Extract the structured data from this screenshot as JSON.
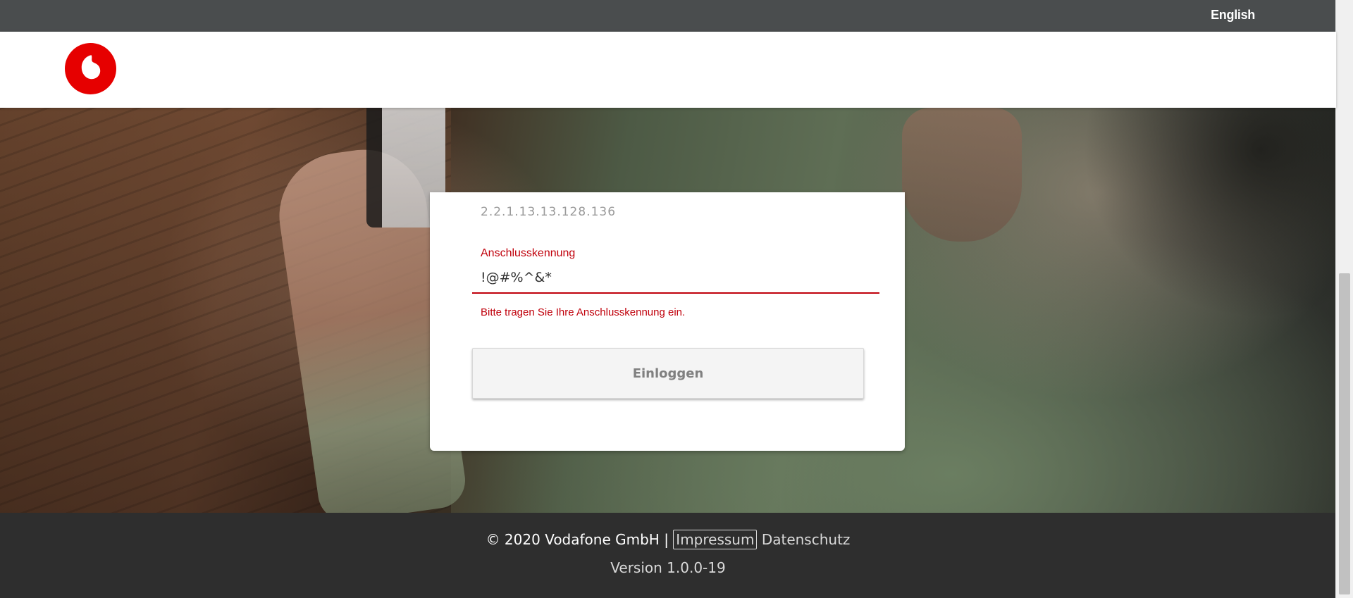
{
  "topbar": {
    "language_link": "English"
  },
  "header": {
    "logo_icon": "vodafone-logo-icon",
    "brand_color": "#e60000"
  },
  "login_form": {
    "previous_field_value": "2.2.1.13.13.128.136",
    "field_label": "Anschlusskennung",
    "field_value": "!@#%^&*",
    "field_error": "Bitte tragen Sie Ihre Anschlusskennung ein.",
    "submit_label": "Einloggen",
    "error_color": "#c0000b"
  },
  "footer": {
    "copyright": "© 2020 Vodafone GmbH |",
    "impressum": "Impressum",
    "datenschutz": "Datenschutz",
    "version": "Version 1.0.0-19"
  }
}
